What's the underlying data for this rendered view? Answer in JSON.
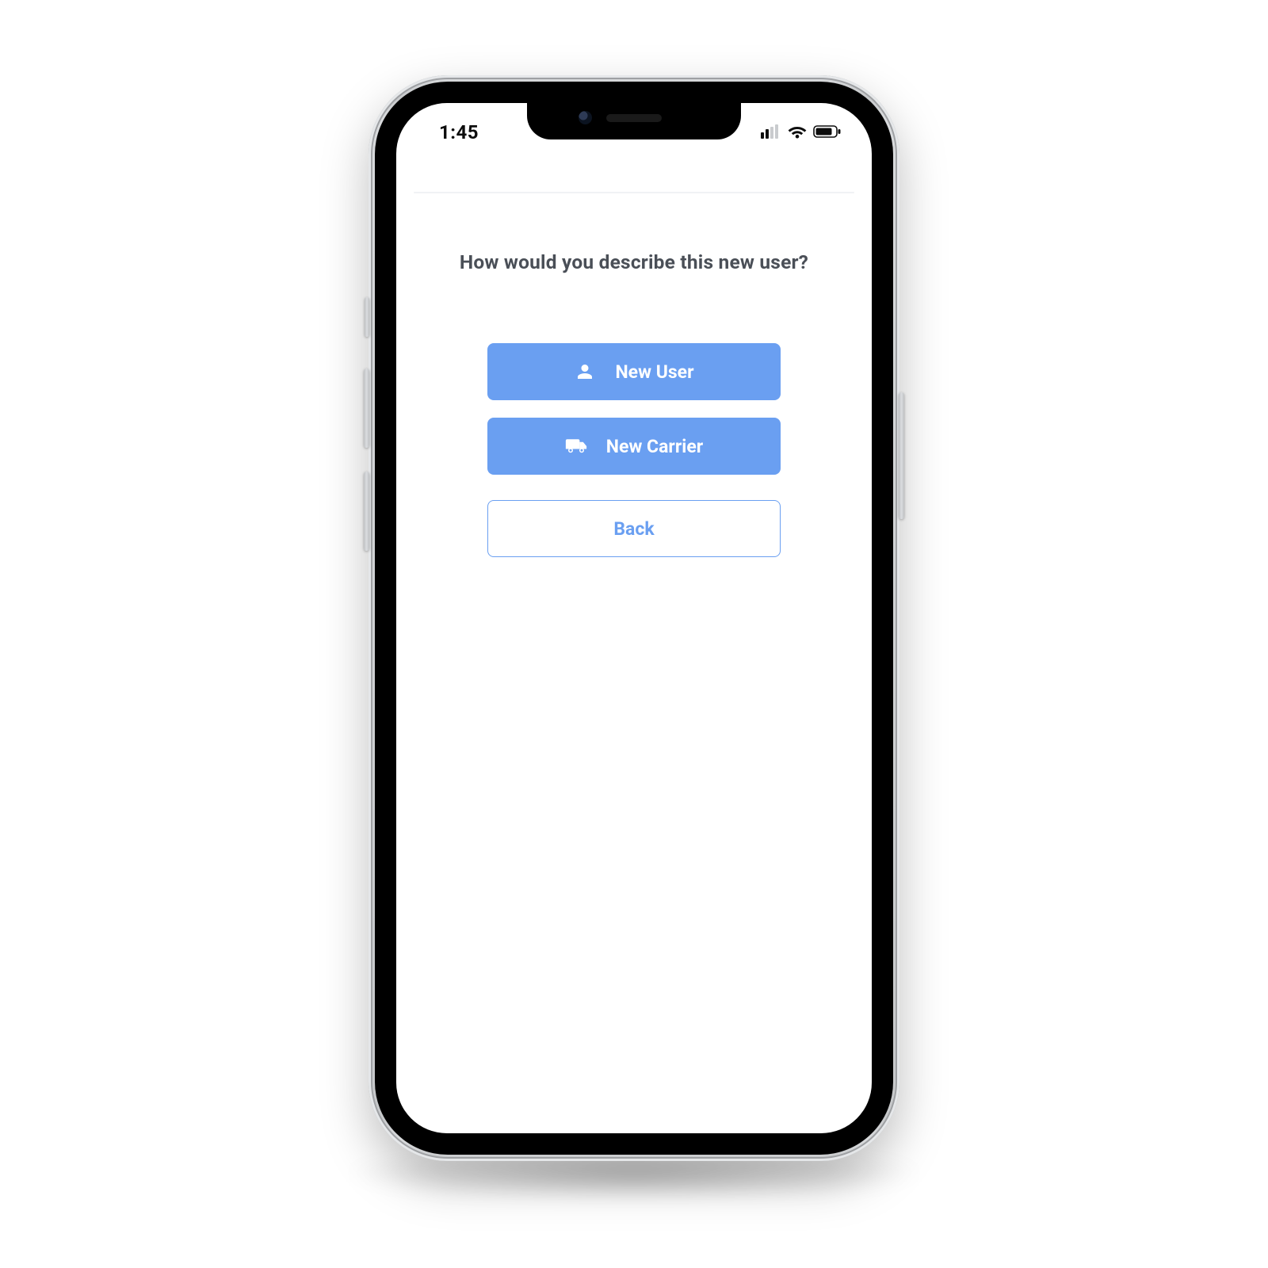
{
  "statusbar": {
    "time": "1:45"
  },
  "page": {
    "title": "How would you describe this new user?"
  },
  "buttons": {
    "new_user": "New User",
    "new_carrier": "New Carrier",
    "back": "Back"
  },
  "colors": {
    "primary": "#6a9ff1",
    "text_muted": "#4a4f57"
  }
}
